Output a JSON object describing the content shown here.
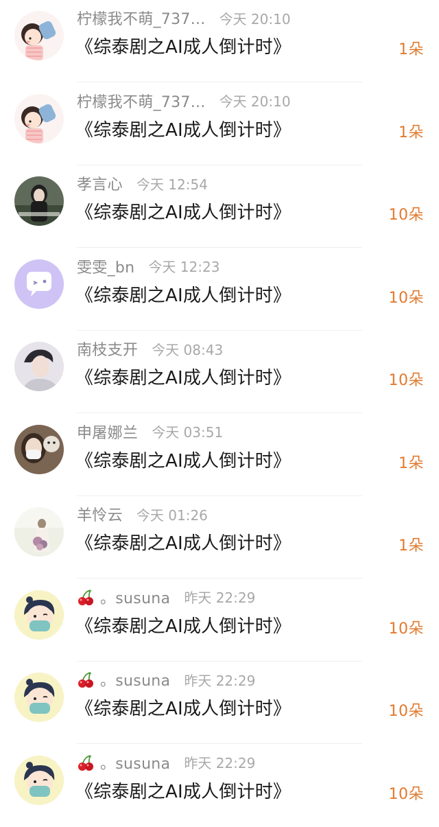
{
  "items": [
    {
      "avatar": "cartoon-girl-drinking-avatar",
      "user": "柠檬我不萌_737...",
      "emoji": "",
      "time": "今天 20:10",
      "title": "《综泰剧之AI成人倒计时》",
      "count": "1朵"
    },
    {
      "avatar": "cartoon-girl-drinking-avatar",
      "user": "柠檬我不萌_737...",
      "emoji": "",
      "time": "今天 20:10",
      "title": "《综泰剧之AI成人倒计时》",
      "count": "1朵"
    },
    {
      "avatar": "dark-hair-woman-photo-avatar",
      "user": "孝言心",
      "emoji": "",
      "time": "今天 12:54",
      "title": "《综泰剧之AI成人倒计时》",
      "count": "10朵"
    },
    {
      "avatar": "purple-chat-bubble-avatar",
      "user": "雯雯_bn",
      "emoji": "",
      "time": "今天 12:23",
      "title": "《综泰剧之AI成人倒计时》",
      "count": "10朵"
    },
    {
      "avatar": "young-man-photo-avatar",
      "user": "南枝支开",
      "emoji": "",
      "time": "今天 08:43",
      "title": "《综泰剧之AI成人倒计时》",
      "count": "10朵"
    },
    {
      "avatar": "masked-woman-with-dog-avatar",
      "user": "申屠娜兰",
      "emoji": "",
      "time": "今天 03:51",
      "title": "《综泰剧之AI成人倒计时》",
      "count": "1朵"
    },
    {
      "avatar": "person-with-flowers-avatar",
      "user": "羊怜云",
      "emoji": "",
      "time": "今天 01:26",
      "title": "《综泰剧之AI成人倒计时》",
      "count": "1朵"
    },
    {
      "avatar": "cartoon-masked-boy-avatar",
      "user": "。susuna",
      "emoji": "cherry-emoji",
      "time": "昨天 22:29",
      "title": "《综泰剧之AI成人倒计时》",
      "count": "10朵"
    },
    {
      "avatar": "cartoon-masked-boy-avatar",
      "user": "。susuna",
      "emoji": "cherry-emoji",
      "time": "昨天 22:29",
      "title": "《综泰剧之AI成人倒计时》",
      "count": "10朵"
    },
    {
      "avatar": "cartoon-masked-boy-avatar",
      "user": "。susuna",
      "emoji": "cherry-emoji",
      "time": "昨天 22:29",
      "title": "《综泰剧之AI成人倒计时》",
      "count": "10朵"
    }
  ],
  "colors": {
    "username": "#8a8a8a",
    "time": "#a8a8a8",
    "title": "#1a1a1a",
    "count": "#e27a2e",
    "divider": "#efefef"
  }
}
